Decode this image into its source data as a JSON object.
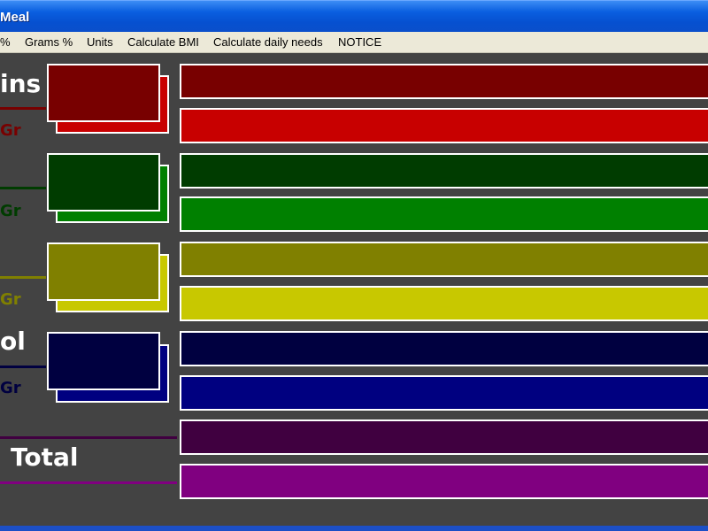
{
  "window": {
    "title": "Meal"
  },
  "menu": {
    "items": [
      {
        "label": "%"
      },
      {
        "label": "Grams %"
      },
      {
        "label": "Units"
      },
      {
        "label": "Calculate BMI"
      },
      {
        "label": "Calculate daily needs"
      },
      {
        "label": "NOTICE"
      }
    ]
  },
  "nutrients": [
    {
      "label": "ins",
      "unit_label": "Gr",
      "dark_color": "#780000",
      "light_color": "#c80000"
    },
    {
      "label": "",
      "unit_label": "Gr",
      "dark_color": "#003c00",
      "light_color": "#008000"
    },
    {
      "label": "",
      "unit_label": "Gr",
      "dark_color": "#808000",
      "light_color": "#c8c800"
    },
    {
      "label": "ol",
      "unit_label": "Gr",
      "dark_color": "#000040",
      "light_color": "#000080"
    }
  ],
  "total": {
    "label": "Total",
    "dark_color": "#400040",
    "light_color": "#800080"
  }
}
